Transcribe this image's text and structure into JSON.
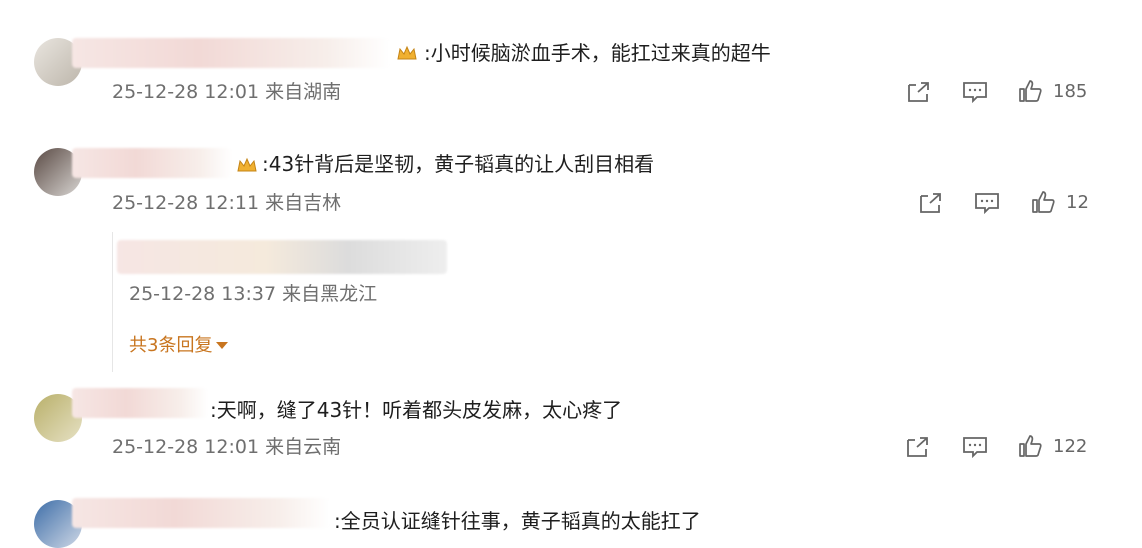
{
  "comments": [
    {
      "text": ":小时候脑淤血手术，能扛过来真的超牛",
      "meta": "25-12-28 12:01 来自湖南",
      "likes": "185"
    },
    {
      "text": ":43针背后是坚韧，黄子韬真的让人刮目相看",
      "meta": "25-12-28 12:11 来自吉林",
      "likes": "12",
      "reply": {
        "meta": "25-12-28 13:37 来自黑龙江",
        "more_label": "共3条回复"
      }
    },
    {
      "text": ":天啊，缝了43针！听着都头皮发麻，太心疼了",
      "meta": "25-12-28 12:01 来自云南",
      "likes": "122"
    },
    {
      "text": ":全员认证缝针往事，黄子韬真的太能扛了"
    }
  ],
  "icons": {
    "share": "share-icon",
    "comment": "comment-icon",
    "like": "thumbs-up-icon",
    "badge": "crown-badge-icon"
  },
  "colors": {
    "more_link": "#c8751f",
    "meta": "#6f6f6f",
    "badge": "#f0b030"
  }
}
